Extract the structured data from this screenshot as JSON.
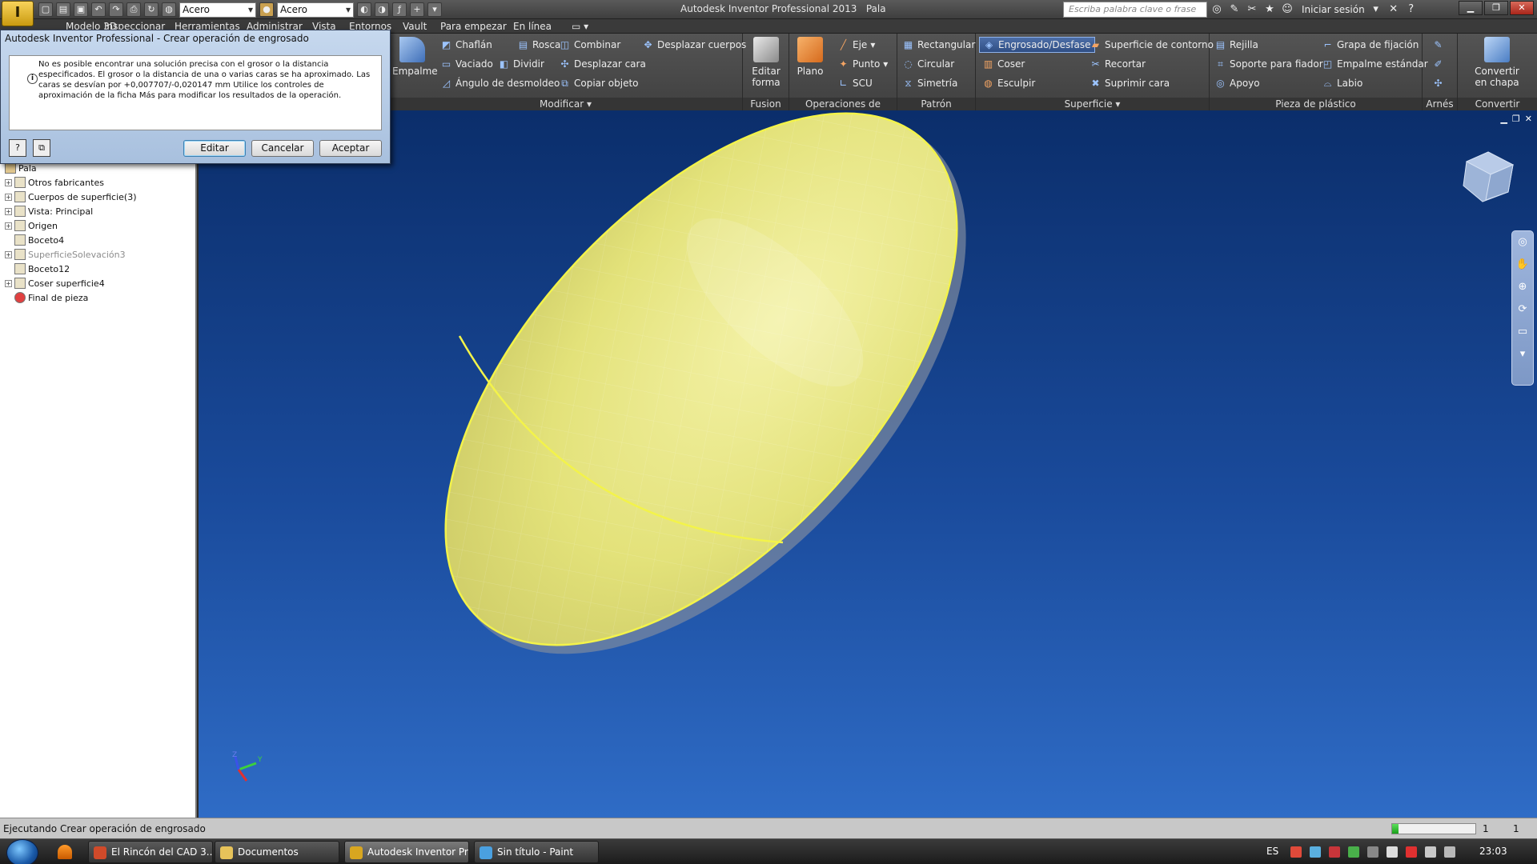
{
  "app": {
    "title": "Autodesk Inventor Professional 2013",
    "document": "Pala",
    "app_button_glyph": "I",
    "material_1": "Acero",
    "material_2": "Acero",
    "search_placeholder": "Escriba palabra clave o frase",
    "sign_in": "Iniciar sesión"
  },
  "menu_tabs": [
    "Modelo 3D",
    "Inspeccionar",
    "Herramientas",
    "Administrar",
    "Vista",
    "Entornos",
    "Vault",
    "Para empezar",
    "En línea"
  ],
  "ribbon": {
    "modificar": {
      "label": "Modificar",
      "empalme": "Empalme",
      "items": [
        "Chaflán",
        "Rosca",
        "Combinar",
        "Desplazar cuerpos",
        "Vaciado",
        "Dividir",
        "Desplazar cara",
        "Ángulo de desmoldeo",
        "Copiar objeto"
      ]
    },
    "fusion": {
      "label": "Fusion",
      "editar_forma": "Editar forma"
    },
    "ops": {
      "label": "Operaciones de trabajo",
      "plano": "Plano",
      "eje": "Eje",
      "punto": "Punto",
      "scu": "SCU"
    },
    "patron": {
      "label": "Patrón",
      "items": [
        "Rectangular",
        "Circular",
        "Simetría"
      ]
    },
    "superficie": {
      "label": "Superficie",
      "items": [
        "Engrosado/Desfase",
        "Superficie de contorno",
        "Coser",
        "Recortar",
        "Esculpir",
        "Suprimir cara"
      ]
    },
    "plastico": {
      "label": "Pieza de plástico",
      "items": [
        "Rejilla",
        "Grapa de fijación",
        "Soporte para fiador",
        "Empalme estándar",
        "Apoyo",
        "Labio"
      ]
    },
    "arnes": {
      "label": "Arnés"
    },
    "convertir": {
      "label": "Convertir",
      "button": "Convertir en chapa"
    }
  },
  "dialog": {
    "title": "Autodesk Inventor Professional - Crear operación de engrosado",
    "message": "No es posible encontrar una solución precisa con el grosor o la distancia especificados. El grosor o la distancia de una o varias caras se ha aproximado. Las caras se desvían por +0,007707/-0,020147 mm   Utilice los controles de aproximación de la ficha Más para modificar los resultados de la operación.",
    "info_glyph": "i",
    "help_glyph": "?",
    "copy_glyph": "⧉",
    "buttons": {
      "edit": "Editar",
      "cancel": "Cancelar",
      "accept": "Aceptar"
    }
  },
  "browser": {
    "root": "Pala",
    "items": [
      {
        "label": "Otros fabricantes",
        "expandable": true,
        "grayed": false
      },
      {
        "label": "Cuerpos de superficie(3)",
        "expandable": true,
        "grayed": false
      },
      {
        "label": "Vista: Principal",
        "expandable": true,
        "grayed": false
      },
      {
        "label": "Origen",
        "expandable": true,
        "grayed": false
      },
      {
        "label": "Boceto4",
        "expandable": false,
        "grayed": false
      },
      {
        "label": "SuperficieSolevación3",
        "expandable": true,
        "grayed": true
      },
      {
        "label": "Boceto12",
        "expandable": false,
        "grayed": false
      },
      {
        "label": "Coser superficie4",
        "expandable": true,
        "grayed": false
      },
      {
        "label": "Final de pieza",
        "expandable": false,
        "grayed": false
      }
    ]
  },
  "status": {
    "text": "Ejecutando Crear operación de engrosado",
    "progress": 0.08,
    "count_1": "1",
    "count_2": "1"
  },
  "taskbar": {
    "items": [
      {
        "label": "El Rincón del CAD 3...",
        "icon": "chrome-icon",
        "color": "#d04a2a",
        "active": false
      },
      {
        "label": "Documentos",
        "icon": "folder-icon",
        "color": "#e7c35a",
        "active": false
      },
      {
        "label": "Autodesk Inventor Pr...",
        "icon": "inventor-icon",
        "color": "#d8a620",
        "active": true
      },
      {
        "label": "Sin título - Paint",
        "icon": "paint-icon",
        "color": "#4aa0e0",
        "active": false
      }
    ],
    "lang": "ES",
    "clock": "23:03"
  },
  "colors": {
    "viewport_top": "#0b2e6b",
    "viewport_bottom": "#2f6cc6",
    "part_fill": "#e6e67a",
    "part_edge": "#f3f34a",
    "active_tool": "#3a5f99"
  },
  "icons": {
    "help": "help-icon",
    "star": "favorites-icon",
    "user": "user-icon",
    "close": "close-icon"
  }
}
